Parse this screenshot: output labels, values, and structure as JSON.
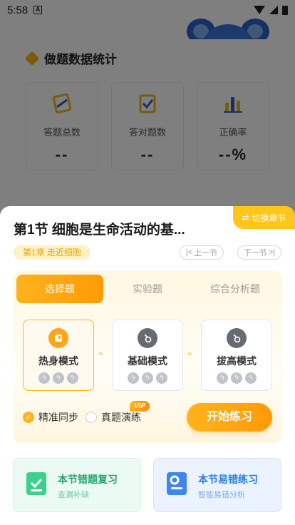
{
  "status_bar": {
    "time": "5:58",
    "app_badge": "A"
  },
  "background": {
    "stats_title": "做题数据统计",
    "stats": [
      {
        "label": "答题总数",
        "value": "--",
        "icon": "pencil-book-icon"
      },
      {
        "label": "答对题数",
        "value": "--",
        "icon": "check-clipboard-icon"
      },
      {
        "label": "正确率",
        "value": "--%",
        "icon": "bar-chart-icon"
      }
    ]
  },
  "sheet": {
    "switch_label": "切换章节",
    "section_title": "第1节 细胞是生命活动的基...",
    "chapter_tag": "第1章 走近细胞",
    "prev_label": "上一节",
    "next_label": "下一节",
    "tabs": [
      {
        "label": "选择题",
        "active": true
      },
      {
        "label": "实验题",
        "active": false
      },
      {
        "label": "综合分析题",
        "active": false
      }
    ],
    "modes": [
      {
        "name": "热身模式",
        "selected": true
      },
      {
        "name": "基础模式",
        "selected": false
      },
      {
        "name": "拔高模式",
        "selected": false
      }
    ],
    "options": {
      "sync_label": "精准同步",
      "real_label": "真题演练",
      "vip_badge": "VIP"
    },
    "start_label": "开始练习",
    "bottom_cards": [
      {
        "title": "本节错题复习",
        "subtitle": "查漏补缺"
      },
      {
        "title": "本节易错练习",
        "subtitle": "智能易错分析"
      }
    ]
  },
  "colors": {
    "accent": "#ffb31c",
    "green": "#23a56d",
    "blue": "#2f7be8"
  }
}
